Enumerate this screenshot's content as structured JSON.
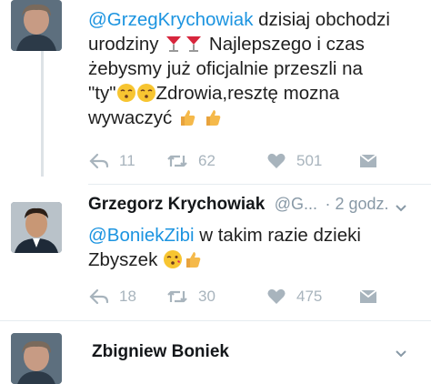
{
  "tweets": [
    {
      "text_mention": "@GrzegKrychowiak",
      "text_l1_rest": " dzisiaj obchodzi",
      "text_l2": "urodziny",
      "text_l2_rest": " Najlepszego i czas",
      "text_l3": "żebysmy już oficjalnie przeszli na",
      "text_l4": "\"ty\"",
      "text_l4_rest": "Zdrowia,resztę mozna",
      "text_l5": "wywaczyć",
      "reply_count": "11",
      "retweet_count": "62",
      "like_count": "501"
    },
    {
      "name": "Grzegorz Krychowiak",
      "handle": "@G...",
      "time": "· 2 godz.",
      "text_mention": "@BoniekZibi",
      "text_l1_rest": " w takim razie dzieki",
      "text_l2": "Zbyszek",
      "reply_count": "18",
      "retweet_count": "30",
      "like_count": "475"
    },
    {
      "name": "Zbigniew Boniek"
    }
  ],
  "icons": {
    "reply": "reply-icon",
    "retweet": "retweet-icon",
    "like": "heart-icon",
    "dm": "direct-message-icon",
    "chevron": "chevron-down-icon"
  },
  "colors": {
    "link": "#1c94e0",
    "muted": "#8899a6",
    "icon": "#a8b4bd"
  }
}
